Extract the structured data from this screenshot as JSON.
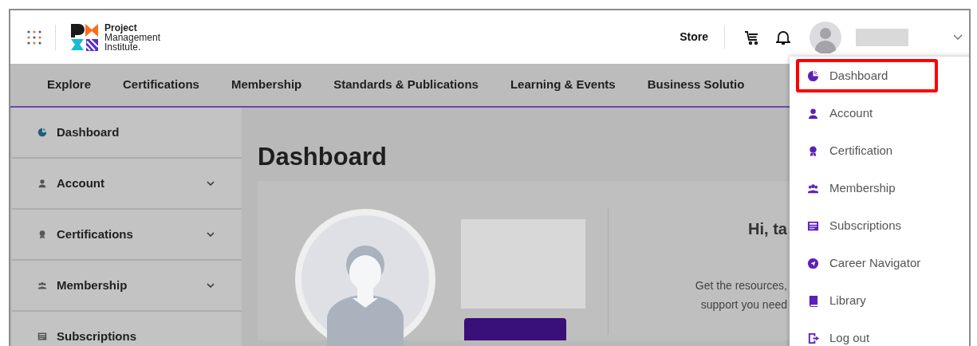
{
  "header": {
    "logo_lines": [
      "Project",
      "Management",
      "Institute."
    ],
    "store": "Store"
  },
  "nav": [
    "Explore",
    "Certifications",
    "Membership",
    "Standards & Publications",
    "Learning & Events",
    "Business Solutio"
  ],
  "sidebar": {
    "items": [
      {
        "label": "Dashboard",
        "expandable": false
      },
      {
        "label": "Account",
        "expandable": true
      },
      {
        "label": "Certifications",
        "expandable": true
      },
      {
        "label": "Membership",
        "expandable": true
      },
      {
        "label": "Subscriptions",
        "expandable": false
      }
    ]
  },
  "content": {
    "title": "Dashboard",
    "greeting": "Hi, ta",
    "intro_lines": [
      "Get the resources,",
      "support you need"
    ]
  },
  "user_menu": {
    "items": [
      {
        "label": "Dashboard",
        "selected": true
      },
      {
        "label": "Account",
        "selected": false
      },
      {
        "label": "Certification",
        "selected": false
      },
      {
        "label": "Membership",
        "selected": false
      },
      {
        "label": "Subscriptions",
        "selected": false
      },
      {
        "label": "Career Navigator",
        "selected": false
      },
      {
        "label": "Library",
        "selected": false
      },
      {
        "label": "Log out",
        "selected": false
      }
    ]
  }
}
